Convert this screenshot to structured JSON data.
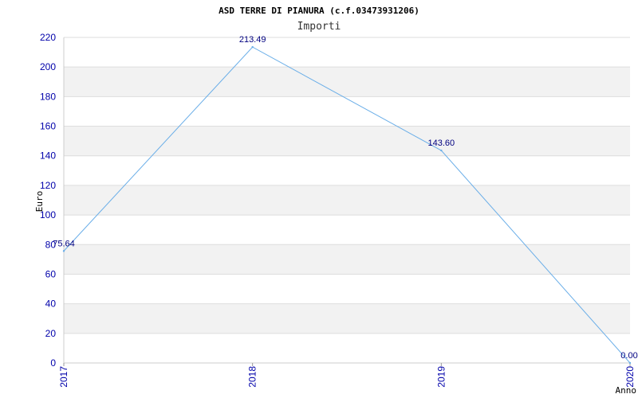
{
  "chart_data": {
    "type": "line",
    "title": "ASD TERRE DI PIANURA (c.f.03473931206)",
    "subtitle": "Importi",
    "xlabel": "Anno",
    "ylabel": "Euro",
    "ylim": [
      0,
      220
    ],
    "yticks": [
      "0",
      "20",
      "40",
      "60",
      "80",
      "100",
      "120",
      "140",
      "160",
      "180",
      "200",
      "220"
    ],
    "categories": [
      "2017",
      "2018",
      "2019",
      "2020"
    ],
    "values": [
      75.64,
      213.49,
      143.6,
      0.0
    ],
    "data_labels": [
      "75.64",
      "213.49",
      "143.60",
      "0.00"
    ],
    "grid": true,
    "colors": {
      "line": "#6aaee8",
      "band": "#f2f2f2",
      "grid": "#dddddd",
      "tick_text": "#0000aa",
      "label_text": "#000080"
    }
  }
}
